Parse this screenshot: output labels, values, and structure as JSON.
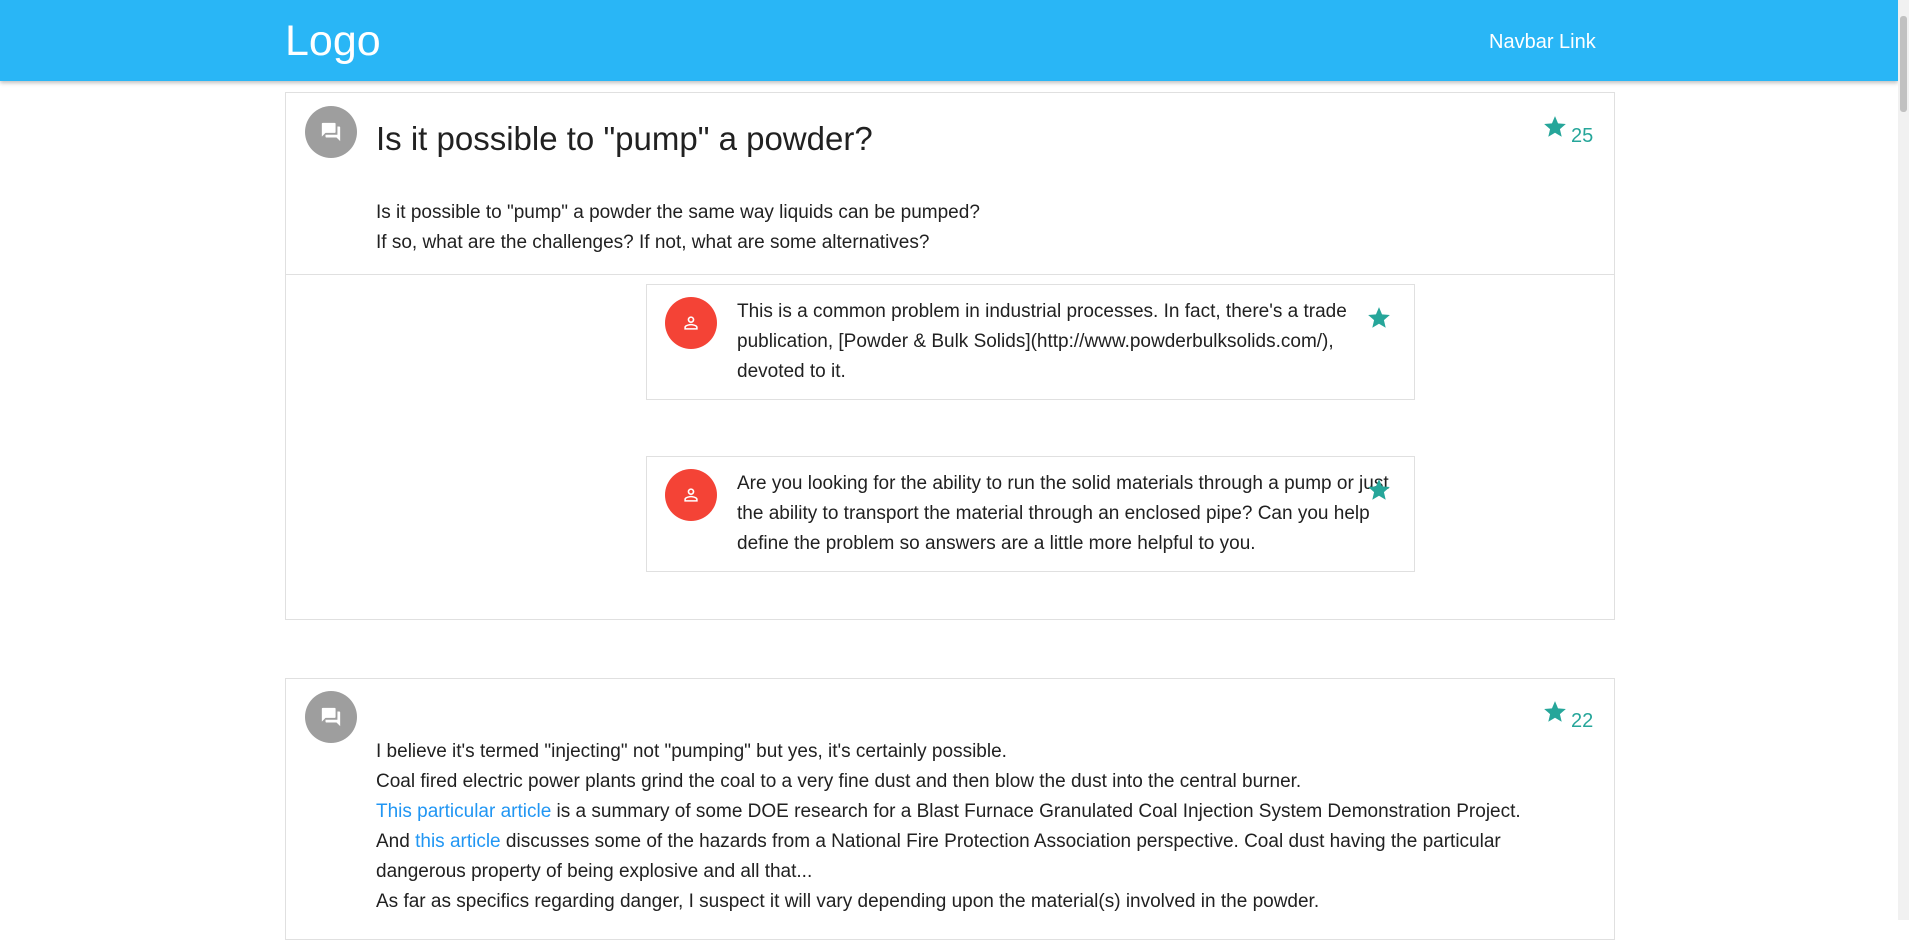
{
  "navbar": {
    "logo": "Logo",
    "link": "Navbar Link"
  },
  "question": {
    "title": "Is it possible to \"pump\" a powder?",
    "star_count": "25",
    "body_lines": [
      "Is it possible to \"pump\" a powder the same way liquids can be pumped?",
      "If so, what are the challenges? If not, what are some alternatives?"
    ],
    "comments": [
      {
        "text": "This is a common problem in industrial processes. In fact, there's a trade publication, [Powder & Bulk Solids](http://www.powderbulksolids.com/), devoted to it."
      },
      {
        "text": "Are you looking for the ability to run the solid materials through a pump or just the ability to transport the material through an enclosed pipe? Can you help define the problem so answers are a little more helpful to you."
      }
    ]
  },
  "answer": {
    "star_count": "22",
    "line1": "I believe it's termed \"injecting\" not \"pumping\" but yes, it's certainly possible.",
    "line2": "Coal fired electric power plants grind the coal to a very fine dust and then blow the dust into the central burner.",
    "line3_link": "This particular article",
    "line3_rest": " is a summary of some DOE research for a Blast Furnace Granulated Coal Injection System Demonstration Project.",
    "line4_pre": "And ",
    "line4_link": "this article",
    "line4_rest": " discusses some of the hazards from a National Fire Protection Association perspective. Coal dust having the particular dangerous property of being explosive and all that...",
    "line5": "As far as specifics regarding danger, I suspect it will vary depending upon the material(s) involved in the powder."
  },
  "colors": {
    "navbar": "#29b6f6",
    "star": "#26a69a",
    "link": "#2196f3",
    "avatar_gray": "#9e9e9e",
    "avatar_red": "#f44336"
  },
  "icons": {
    "question_avatar": "forum-icon",
    "comment_avatar": "person-icon",
    "star": "star-icon"
  }
}
